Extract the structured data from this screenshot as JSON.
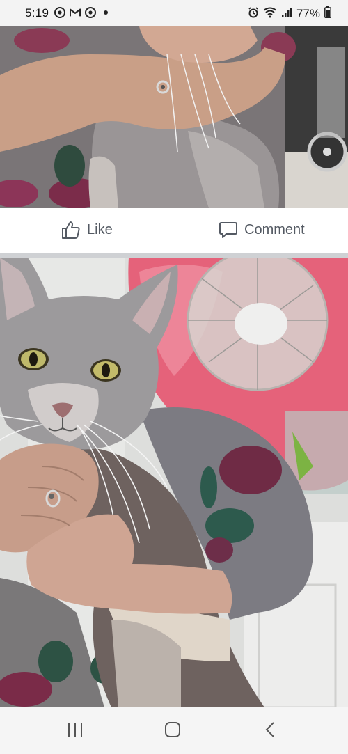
{
  "status_bar": {
    "time": "5:19",
    "battery": "77%",
    "notification_icons": [
      "chrome-icon",
      "gmail-icon",
      "chrome-icon",
      "dot-icon"
    ]
  },
  "post": {
    "actions": {
      "like_label": "Like",
      "comment_label": "Comment"
    }
  },
  "colors": {
    "action_text": "#545a63",
    "separator": "#cfd1d4",
    "status_bg": "#f3f3f3",
    "nav_bg": "#f5f5f5"
  }
}
